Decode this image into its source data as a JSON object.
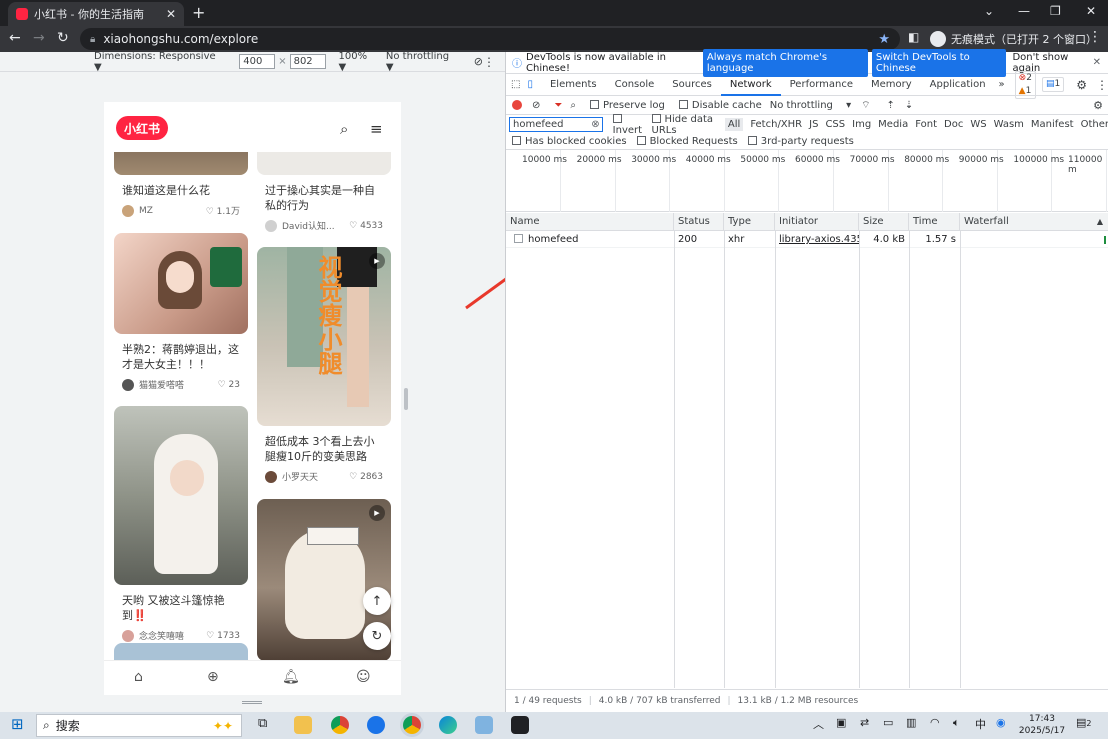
{
  "browser": {
    "tab_title": "小红书 - 你的生活指南",
    "url": "xiaohongshu.com/explore",
    "incognito_label": "无痕模式（已打开 2 个窗口）"
  },
  "device_toolbar": {
    "dimensions_label": "Dimensions: Responsive ▼",
    "width": "400",
    "height": "802",
    "times": "×",
    "zoom": "100% ▼",
    "throttling": "No throttling ▼"
  },
  "phone": {
    "logo": "小红书",
    "cards": [
      {
        "title": "谁知道这是什么花",
        "user": "MZ",
        "likes": "1.1万"
      },
      {
        "title": "过于操心其实是一种自私的行为",
        "user": "David认知...",
        "likes": "4533"
      },
      {
        "title": "半熟2：蒋鹊婷退出，这才是大女主！！！",
        "user": "猫猫爱嗒嗒",
        "likes": "23"
      },
      {
        "title": "超低成本 3个看上去小腿瘦10斤的变美思路",
        "user": "小罗天天",
        "likes": "2863",
        "overlay": "视觉瘦小腿"
      },
      {
        "title": "天哟 又被这斗篷惊艳到‼️",
        "user": "念念笑嘻嘻",
        "likes": "1733"
      }
    ],
    "heart": "♡"
  },
  "devtools": {
    "info_text": "DevTools is now available in Chinese!",
    "btn_match": "Always match Chrome's language",
    "btn_switch": "Switch DevTools to Chinese",
    "btn_dont_show": "Don't show again",
    "tabs": [
      "Elements",
      "Console",
      "Sources",
      "Network",
      "Performance",
      "Memory",
      "Application"
    ],
    "more_tabs": "»",
    "errors": "2",
    "warnings": "1",
    "messages": "1",
    "preserve_log": "Preserve log",
    "disable_cache": "Disable cache",
    "throttling": "No throttling",
    "filter_value": "homefeed",
    "invert": "Invert",
    "hide_data_urls": "Hide data URLs",
    "filter_types": [
      "All",
      "Fetch/XHR",
      "JS",
      "CSS",
      "Img",
      "Media",
      "Font",
      "Doc",
      "WS",
      "Wasm",
      "Manifest",
      "Other"
    ],
    "blocked_cookies": "Has blocked cookies",
    "blocked_requests": "Blocked Requests",
    "third_party": "3rd-party requests",
    "timeline_labels": [
      "10000 ms",
      "20000 ms",
      "30000 ms",
      "40000 ms",
      "50000 ms",
      "60000 ms",
      "70000 ms",
      "80000 ms",
      "90000 ms",
      "100000 ms",
      "110000 m"
    ],
    "columns": [
      "Name",
      "Status",
      "Type",
      "Initiator",
      "Size",
      "Time",
      "Waterfall"
    ],
    "sort_icon": "▲",
    "rows": [
      {
        "name": "homefeed",
        "status": "200",
        "type": "xhr",
        "initiator": "library-axios.435d...",
        "size": "4.0 kB",
        "time": "1.57 s"
      }
    ],
    "status": {
      "requests": "1 / 49 requests",
      "transferred": "4.0 kB / 707 kB transferred",
      "resources": "13.1 kB / 1.2 MB resources"
    }
  },
  "taskbar": {
    "search_label": "搜索",
    "ime": "中",
    "time": "17:43",
    "date": "2025/5/17",
    "notifications": "2"
  }
}
